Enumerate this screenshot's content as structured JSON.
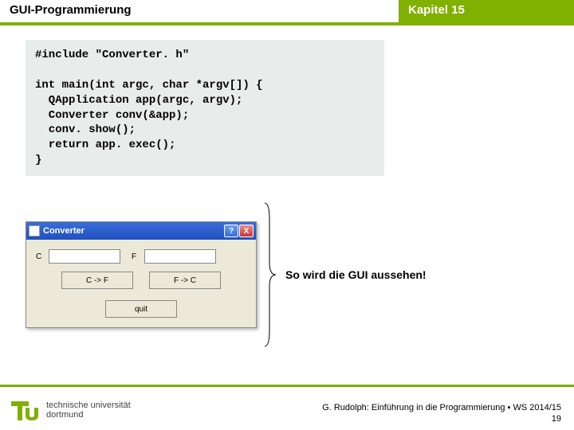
{
  "header": {
    "left": "GUI-Programmierung",
    "right": "Kapitel 15"
  },
  "code": "#include \"Converter. h\"\n\nint main(int argc, char *argv[]) {\n  QApplication app(argc, argv);\n  Converter conv(&app);\n  conv. show();\n  return app. exec();\n}",
  "gui": {
    "title": "Converter",
    "help": "?",
    "close": "X",
    "label_c": "C",
    "label_f": "F",
    "btn_cf": "C -> F",
    "btn_fc": "F -> C",
    "btn_quit": "quit"
  },
  "caption": "So wird die GUI aussehen!",
  "logo": {
    "line1": "technische universität",
    "line2": "dortmund"
  },
  "footer": "G. Rudolph: Einführung in die Programmierung ▪ WS 2014/15",
  "page": "19"
}
